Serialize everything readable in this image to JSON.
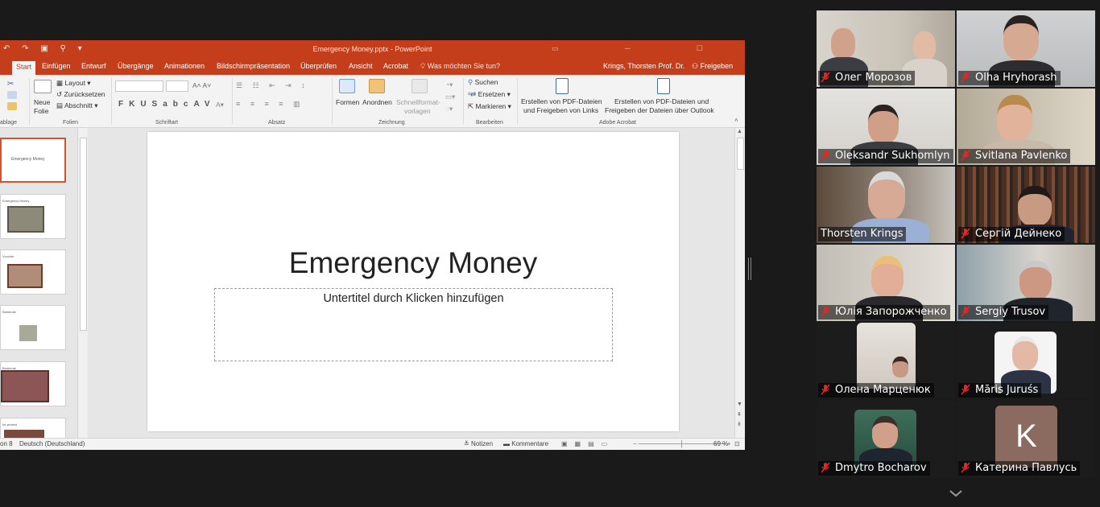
{
  "powerpoint": {
    "window_title": "Emergency Money.pptx - PowerPoint",
    "tabs": [
      "Start",
      "Einfügen",
      "Entwurf",
      "Übergänge",
      "Animationen",
      "Bildschirmpräsentation",
      "Überprüfen",
      "Ansicht",
      "Acrobat"
    ],
    "active_tab": "Start",
    "tell_me": "Was möchten Sie tun?",
    "account": "Krings, Thorsten Prof. Dr.",
    "share": "Freigeben",
    "ribbon": {
      "clipboard_label": "ablage",
      "new_slide": "Neue",
      "new_slide_2": "Folie",
      "layout": "Layout",
      "reset": "Zurücksetzen",
      "section": "Abschnitt",
      "slides_label": "Folien",
      "font_label": "Schriftart",
      "paragraph_label": "Absatz",
      "shapes": "Formen",
      "arrange": "Anordnen",
      "quick_styles": "Schnellformat-",
      "quick_styles_2": "vorlagen",
      "drawing_label": "Zeichnung",
      "find": "Suchen",
      "replace": "Ersetzen",
      "select": "Markieren",
      "editing_label": "Bearbeiten",
      "pdf_links": "Erstellen von PDF-Dateien",
      "pdf_links_2": "und Freigeben von Links",
      "pdf_outlook": "Erstellen von PDF-Dateien und",
      "pdf_outlook_2": "Freigeben der Dateien über Outlook",
      "acrobat_label": "Adobe Acrobat"
    },
    "thumbnails": [
      {
        "caption": "Emergency Money"
      },
      {
        "caption": "Emergency Money"
      },
      {
        "caption": "Voucher"
      },
      {
        "caption": "Banknote"
      },
      {
        "caption": "Banknote"
      },
      {
        "caption": "for protest"
      }
    ],
    "slide": {
      "title": "Emergency Money",
      "subtitle_placeholder": "Untertitel durch Klicken hinzufügen"
    },
    "status": {
      "slide_info": "on 8",
      "language": "Deutsch (Deutschland)",
      "notes": "Notizen",
      "comments": "Kommentare",
      "zoom": "69 %"
    }
  },
  "participants": [
    {
      "name": "Олег Морозов",
      "muted": true,
      "speaking": false
    },
    {
      "name": "Olha Hryhorash",
      "muted": true,
      "speaking": false
    },
    {
      "name": "Oleksandr Sukhomlyn",
      "muted": true,
      "speaking": false
    },
    {
      "name": "Svitlana Pavlenko",
      "muted": true,
      "speaking": false
    },
    {
      "name": "Thorsten Krings",
      "muted": false,
      "speaking": true
    },
    {
      "name": "Сергій Дейнеко",
      "muted": true,
      "speaking": false
    },
    {
      "name": "Юлія Запорожченко",
      "muted": true,
      "speaking": false
    },
    {
      "name": "Sergiy Trusov",
      "muted": true,
      "speaking": false
    },
    {
      "name": "Олена Марценюк",
      "muted": true,
      "speaking": false
    },
    {
      "name": "Māris Juruśs",
      "muted": true,
      "speaking": false
    },
    {
      "name": "Dmytro Bocharov",
      "muted": true,
      "speaking": false
    },
    {
      "name": "Катерина Павлусь",
      "muted": true,
      "speaking": false,
      "avatar_letter": "K"
    }
  ],
  "colors": {
    "ppt_accent": "#c43e1c",
    "speaking_border": "#23d95a",
    "muted_icon": "#e02828"
  }
}
